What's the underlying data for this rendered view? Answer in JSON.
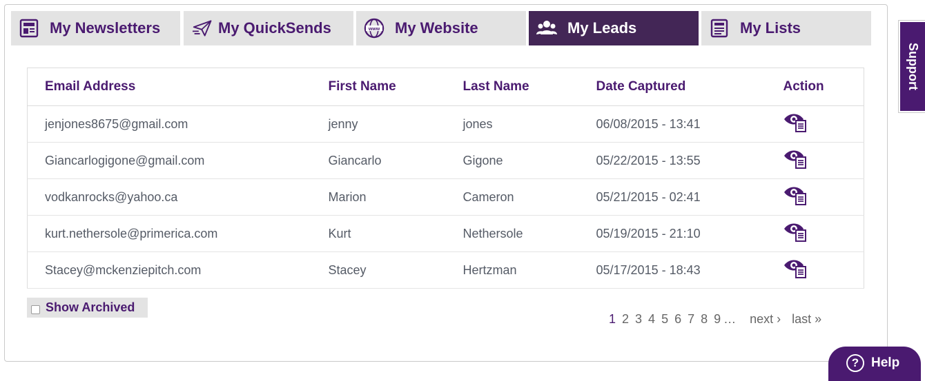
{
  "tabs": [
    {
      "label": "My Newsletters",
      "icon": "newsletter-icon",
      "active": false
    },
    {
      "label": "My QuickSends",
      "icon": "quicksend-icon",
      "active": false
    },
    {
      "label": "My Website",
      "icon": "website-icon",
      "active": false
    },
    {
      "label": "My Leads",
      "icon": "leads-icon",
      "active": true
    },
    {
      "label": "My Lists",
      "icon": "lists-icon",
      "active": false
    }
  ],
  "table": {
    "headers": [
      "Email Address",
      "First Name",
      "Last Name",
      "Date Captured",
      "Action"
    ],
    "rows": [
      {
        "email": "jenjones8675@gmail.com",
        "first": "jenny",
        "last": "jones",
        "date": "06/08/2015 - 13:41"
      },
      {
        "email": "Giancarlogigone@gmail.com",
        "first": "Giancarlo",
        "last": "Gigone",
        "date": "05/22/2015 - 13:55"
      },
      {
        "email": "vodkanrocks@yahoo.ca",
        "first": "Marion",
        "last": "Cameron",
        "date": "05/21/2015 - 02:41"
      },
      {
        "email": "kurt.nethersole@primerica.com",
        "first": "Kurt",
        "last": "Nethersole",
        "date": "05/19/2015 - 21:10"
      },
      {
        "email": "Stacey@mckenziepitch.com",
        "first": "Stacey",
        "last": "Hertzman",
        "date": "05/17/2015 - 18:43"
      }
    ]
  },
  "archived": {
    "label": "Show Archived",
    "checked": false
  },
  "pagination": {
    "pages": [
      "1",
      "2",
      "3",
      "4",
      "5",
      "6",
      "7",
      "8",
      "9"
    ],
    "current": "1",
    "ellipsis": "…",
    "next": "next ›",
    "last": "last »"
  },
  "support_label": "Support",
  "help_label": "Help",
  "help_icon_glyph": "?",
  "colors": {
    "brand": "#4a1a70",
    "active_tab": "#432656",
    "tab_bg": "#e3e3e3",
    "text": "#555b66"
  }
}
